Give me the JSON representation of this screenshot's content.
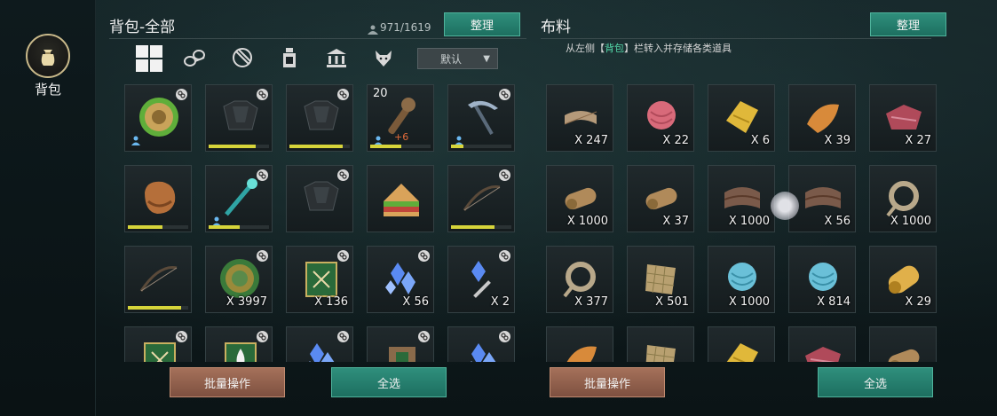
{
  "nav": {
    "bag_label": "背包"
  },
  "left_panel": {
    "title": "背包-全部",
    "capacity": "971/1619",
    "sort_label": "整理",
    "dropdown_value": "默认",
    "tabs": [
      "all-icon",
      "wood-icon",
      "leaf-icon",
      "bottle-icon",
      "bank-icon",
      "wolf-icon"
    ],
    "batch_label": "批量操作",
    "select_all_label": "全选",
    "slots": [
      {
        "art": "disc-green",
        "link": true,
        "bind": true
      },
      {
        "art": "armor-dark",
        "link": true,
        "dur": 0.75
      },
      {
        "art": "armor-dark",
        "link": true,
        "dur": 0.85
      },
      {
        "art": "club",
        "label": "20",
        "bind": true,
        "plus": "+6",
        "dur": 0.5
      },
      {
        "art": "pickaxe",
        "link": true,
        "bind": true,
        "dur": 0.2
      },
      {
        "art": "glove-copper",
        "dur": 0.55
      },
      {
        "art": "staff-teal",
        "link": true,
        "bind": true,
        "dur": 0.5
      },
      {
        "art": "armor-dark",
        "link": true
      },
      {
        "art": "sandwich"
      },
      {
        "art": "bow",
        "link": true,
        "dur": 0.7
      },
      {
        "art": "bow",
        "dur": 0.85
      },
      {
        "art": "medal",
        "link": true,
        "qty": "X 3997"
      },
      {
        "art": "book-green",
        "link": true,
        "qty": "X 136"
      },
      {
        "art": "crystal",
        "link": true,
        "qty": "X 56"
      },
      {
        "art": "crystal-sword",
        "link": true,
        "qty": "X 2"
      },
      {
        "art": "book-green",
        "link": true
      },
      {
        "art": "book-fire",
        "link": true
      },
      {
        "art": "crystal",
        "link": true
      },
      {
        "art": "scroll",
        "link": true
      },
      {
        "art": "crystal",
        "link": true
      }
    ]
  },
  "right_panel": {
    "title": "布料",
    "sort_label": "整理",
    "hint_prefix": "从左侧【",
    "hint_highlight": "背包",
    "hint_suffix": "】栏转入并存储各类道具",
    "batch_label": "批量操作",
    "select_all_label": "全选",
    "slots": [
      {
        "art": "bandage",
        "qty": "X 247"
      },
      {
        "art": "yarn-pink",
        "qty": "X 22"
      },
      {
        "art": "cloth-gold",
        "qty": "X 6"
      },
      {
        "art": "cloth-orange",
        "qty": "X 39"
      },
      {
        "art": "cloth-red",
        "qty": "X 27"
      },
      {
        "art": "roll-tan",
        "qty": "X 1000"
      },
      {
        "art": "roll-tan",
        "qty": "X 37"
      },
      {
        "art": "leather",
        "qty": "X 1000"
      },
      {
        "art": "leather",
        "qty": "X 56"
      },
      {
        "art": "rope",
        "qty": "X 1000"
      },
      {
        "art": "rope",
        "qty": "X 377"
      },
      {
        "art": "mesh",
        "qty": "X 501"
      },
      {
        "art": "yarn-blue",
        "qty": "X 1000"
      },
      {
        "art": "yarn-blue",
        "qty": "X 814"
      },
      {
        "art": "roll-gold",
        "qty": "X 29"
      },
      {
        "art": "cloth-orange"
      },
      {
        "art": "mesh"
      },
      {
        "art": "cloth-gold"
      },
      {
        "art": "cloth-red"
      },
      {
        "art": "roll-tan"
      }
    ]
  },
  "colors": {
    "accent_green": "#2f8f7c",
    "accent_brown": "#a5715a",
    "durability": "#d6d43a",
    "hint_highlight": "#54d7a8"
  }
}
